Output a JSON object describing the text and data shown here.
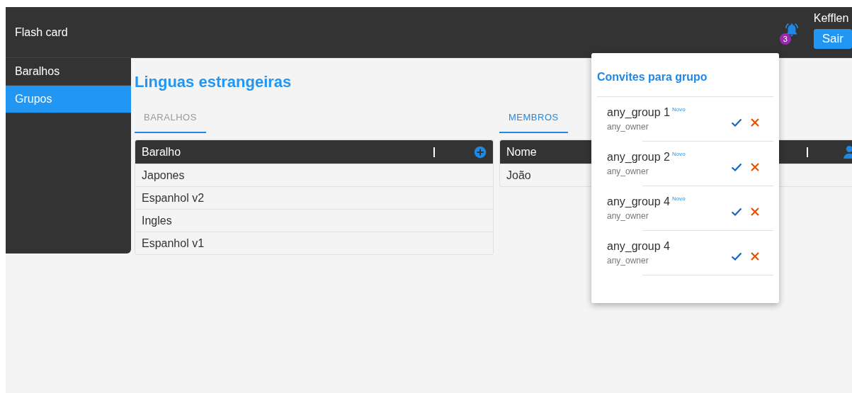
{
  "header": {
    "title": "Flash card",
    "notification_count": "3",
    "user": "Kefflen",
    "logout_button": "Sair"
  },
  "sidebar": {
    "items": [
      {
        "label": "Baralhos",
        "selected": false
      },
      {
        "label": "Grupos",
        "selected": true
      }
    ]
  },
  "page_title": "Linguas estrangeiras",
  "panels": [
    {
      "tab": {
        "label": "BARALHOS",
        "selected": false
      },
      "column": "Baralho",
      "kind": "add",
      "rows": [
        "Japones",
        "Espanhol v2",
        "Ingles",
        "Espanhol v1"
      ]
    },
    {
      "tab": {
        "label": "MEMBROS",
        "selected": true
      },
      "column": "Nome",
      "kind": "member",
      "rows": [
        "João"
      ]
    }
  ],
  "invites_popup": {
    "title": "Convites para grupo",
    "items": [
      {
        "group": "any_group 1",
        "badge": "Novo",
        "owner": "any_owner"
      },
      {
        "group": "any_group 2",
        "badge": "Novo",
        "owner": "any_owner"
      },
      {
        "group": "any_group 4",
        "badge": "Novo",
        "owner": "any_owner"
      },
      {
        "group": "any_group 4",
        "owner": "any_owner"
      }
    ]
  }
}
